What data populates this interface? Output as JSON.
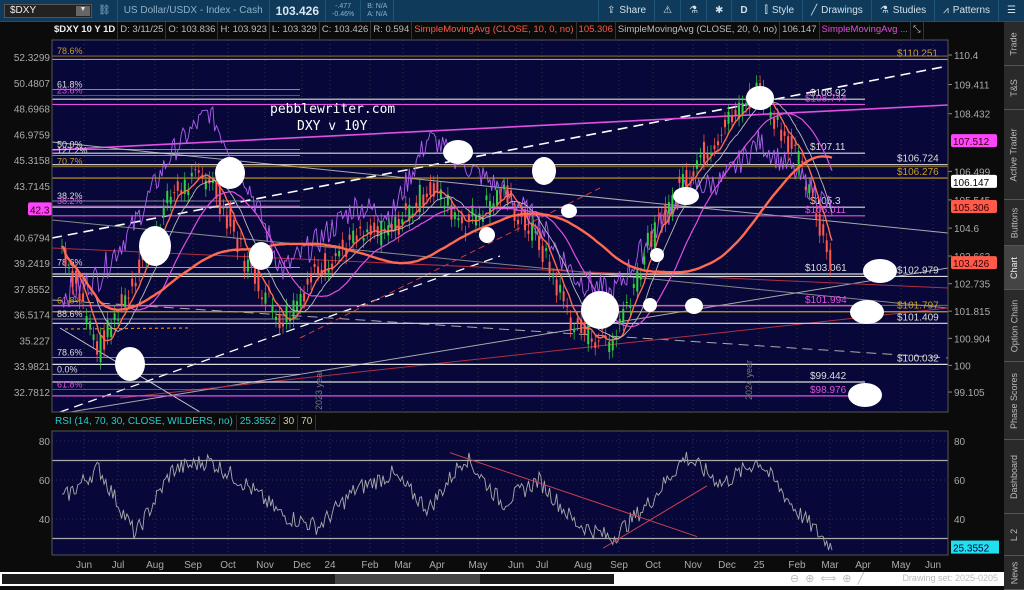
{
  "toolbar": {
    "symbol": "$DXY",
    "description": "US Dollar/USDX - Index - Cash",
    "last": "103.426",
    "change": "-.477",
    "change_pct": "-0.46%",
    "bid": "B: N/A",
    "ask": "A: N/A",
    "share": "Share",
    "aggregation": "D",
    "style": "Style",
    "drawings": "Drawings",
    "studies": "Studies",
    "patterns": "Patterns"
  },
  "header": {
    "title": "$DXY 10 Y 1D",
    "date": "D: 3/11/25",
    "open": "O: 103.836",
    "high": "H: 103.923",
    "low": "L: 103.329",
    "close": "C: 103.426",
    "range": "R: 0.594",
    "sma10_label": "SimpleMovingAvg (CLOSE, 10, 0, no)",
    "sma10_value": "105.306",
    "sma20_label": "SimpleMovingAvg (CLOSE, 20, 0, no)",
    "sma20_value": "106.147",
    "sma3_label": "SimpleMovingAvg ..."
  },
  "annotation": {
    "line1": "pebblewriter.com",
    "line2": "DXY v 10Y",
    "year2023": "2023 year",
    "year2024": "2024 year"
  },
  "chart_data": {
    "type": "line",
    "title": "$DXY 10 Y 1D",
    "right_axis_ticks": [
      "110.4",
      "109.411",
      "108.432",
      "106.499",
      "105.545",
      "104.6",
      "103.663",
      "102.735",
      "101.815",
      "100.904",
      "100",
      "99.105"
    ],
    "left_axis_ticks": [
      "52.3299",
      "50.4807",
      "48.6968",
      "46.9759",
      "45.3158",
      "43.7145",
      "42",
      "40.6794",
      "39.2419",
      "37.8552",
      "36.5174",
      "35.227",
      "33.9821",
      "32.7812"
    ],
    "price_badges": [
      {
        "value": "107.512",
        "color": "#ff44ff"
      },
      {
        "value": "106.147",
        "color": "#ffffff"
      },
      {
        "value": "105.306",
        "color": "#ff5a4a"
      },
      {
        "value": "103.426",
        "color": "#ff5a4a"
      }
    ],
    "left_badge": {
      "value": "42.3",
      "color": "#ff44ff"
    },
    "x_labels": [
      "Jun",
      "Jul",
      "Aug",
      "Sep",
      "Oct",
      "Nov",
      "Dec",
      "24",
      "Feb",
      "Mar",
      "Apr",
      "May",
      "Jun",
      "Jul",
      "Aug",
      "Sep",
      "Oct",
      "Nov",
      "Dec",
      "25",
      "Feb",
      "Mar",
      "Apr",
      "May",
      "Jun"
    ],
    "dxy_monthly": [
      104,
      100.5,
      103,
      105.8,
      106.4,
      103.5,
      101.5,
      103.3,
      104.2,
      104.5,
      106.0,
      104.8,
      105.8,
      104.1,
      101.2,
      100.8,
      104.1,
      106.4,
      107.9,
      109.3,
      107.1,
      103.4
    ],
    "tnx_monthly": [
      37.5,
      38.5,
      41.5,
      45.8,
      48.5,
      44.2,
      38.8,
      40.5,
      42.5,
      42.0,
      46.8,
      45.0,
      43.5,
      41.5,
      38.5,
      37.5,
      40.5,
      43.5,
      44.0,
      46.5,
      44.5,
      42.3
    ],
    "levels": [
      {
        "label": "$110.251",
        "value": 110.251,
        "color": "#c8a020"
      },
      {
        "label": "$108.92",
        "value": 108.92,
        "color": "#dddddd"
      },
      {
        "label": "$108.744",
        "value": 108.744,
        "color": "#e050e0"
      },
      {
        "label": "$107.11",
        "value": 107.11,
        "color": "#dddddd"
      },
      {
        "label": "$106.724",
        "value": 106.724,
        "color": "#dddddd"
      },
      {
        "label": "$106.276",
        "value": 106.276,
        "color": "#c8a020"
      },
      {
        "label": "$105.3",
        "value": 105.3,
        "color": "#dddddd"
      },
      {
        "label": "$105.011",
        "value": 105.011,
        "color": "#e050e0"
      },
      {
        "label": "$103.061",
        "value": 103.061,
        "color": "#dddddd"
      },
      {
        "label": "$102.979",
        "value": 102.979,
        "color": "#dddddd"
      },
      {
        "label": "$101.994",
        "value": 101.994,
        "color": "#e050e0"
      },
      {
        "label": "$101.797",
        "value": 101.797,
        "color": "#c8a020"
      },
      {
        "label": "$101.409",
        "value": 101.409,
        "color": "#dddddd"
      },
      {
        "label": "$100.032",
        "value": 100.032,
        "color": "#dddddd"
      },
      {
        "label": "$99.442",
        "value": 99.442,
        "color": "#dddddd"
      },
      {
        "label": "$98.976",
        "value": 98.976,
        "color": "#e050e0"
      }
    ],
    "fib_labels": [
      {
        "label": "78.6%",
        "tnx": 52.4,
        "color": "#c8a020"
      },
      {
        "label": "61.8%",
        "tnx": 50.0,
        "color": "#dddddd"
      },
      {
        "label": "23.6%",
        "tnx": 49.6,
        "color": "#e050e0"
      },
      {
        "label": "50.0%",
        "tnx": 46.0,
        "color": "#dddddd"
      },
      {
        "label": "127.2%",
        "tnx": 45.6,
        "color": "#dddddd"
      },
      {
        "label": "70.7%",
        "tnx": 44.9,
        "color": "#c8a020"
      },
      {
        "label": "38.2%",
        "tnx": 42.8,
        "color": "#dddddd"
      },
      {
        "label": "38.2%",
        "tnx": 42.5,
        "color": "#e050e0"
      },
      {
        "label": "78.6%",
        "tnx": 39.0,
        "color": "#dddddd"
      },
      {
        "label": "61.8%",
        "tnx": 37.0,
        "color": "#c8a020"
      },
      {
        "label": "88.6%",
        "tnx": 36.3,
        "color": "#dddddd"
      },
      {
        "label": "78.6%",
        "tnx": 34.4,
        "color": "#dddddd"
      },
      {
        "label": "0.0%",
        "tnx": 33.6,
        "color": "#dddddd"
      },
      {
        "label": "61.8%",
        "tnx": 32.9,
        "color": "#e050e0"
      }
    ],
    "rsi": {
      "label": "RSI (14, 70, 30, CLOSE, WILDERS, no)",
      "value": "25.3552",
      "overbought": "70",
      "oversold": "30",
      "ticks": [
        "80",
        "60",
        "40"
      ],
      "monthly": [
        50,
        66,
        32,
        65,
        70,
        58,
        42,
        36,
        55,
        63,
        45,
        72,
        48,
        60,
        38,
        30,
        48,
        72,
        58,
        70,
        45,
        25.4
      ]
    }
  },
  "bottom": {
    "drawing_set": "Drawing set: 2025-0205"
  },
  "sidebar": [
    "Trade",
    "T&S",
    "Active Trader",
    "Buttons",
    "Chart",
    "Option Chain",
    "Phase Scores",
    "Dashboard",
    "L 2",
    "News"
  ]
}
